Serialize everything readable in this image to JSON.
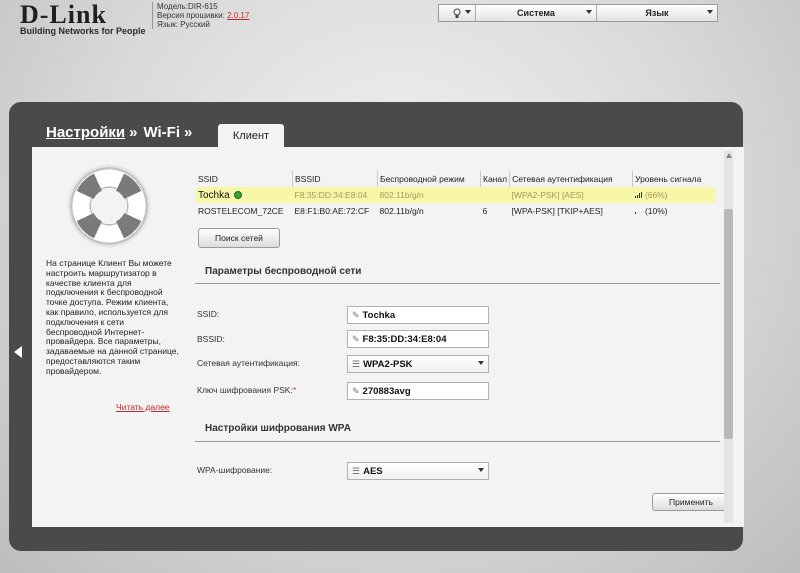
{
  "header": {
    "brand": "D-Link",
    "tagline": "Building Networks for People",
    "model": "Модель:DIR-615",
    "firmware_label": "Версия прошивки:",
    "firmware_version": "2.0.17",
    "language_info": "Язык: Русский",
    "menu": {
      "system": "Система",
      "language": "Язык"
    }
  },
  "breadcrumb": {
    "settings": "Настройки",
    "wifi": "Wi-Fi",
    "separator": "»",
    "tab": "Клиент"
  },
  "sidebar": {
    "help_text": "На странице Клиент Вы можете настроить маршрутизатор в качестве клиента для подключения к беспроводной точке доступа. Режим клиента, как правило, используется для подключения к сети беспроводной Интернет-провайдера. Все параметры, задаваемые на данной странице, предоставляются таким провайдером.",
    "read_more": "Читать далее"
  },
  "networks": {
    "columns": [
      "SSID",
      "BSSID",
      "Беспроводной режим",
      "Канал",
      "Сетевая аутентификация",
      "Уровень сигнала"
    ],
    "rows": [
      {
        "ssid": "Tochka",
        "bssid": "F8:35:DD:34:E8:04",
        "mode": "802.11b/g/n",
        "channel": "",
        "auth": "[WPA2-PSK] [AES]",
        "signal": "(66%)",
        "selected": true
      },
      {
        "ssid": "ROSTELECOM_72CE",
        "bssid": "E8:F1:B0:AE:72:CF",
        "mode": "802.11b/g/n",
        "channel": "6",
        "auth": "[WPA-PSK] [TKIP+AES]",
        "signal": "(10%)",
        "selected": false
      }
    ],
    "search_button": "Поиск сетей"
  },
  "wireless_params": {
    "title": "Параметры беспроводной сети",
    "ssid_label": "SSID:",
    "ssid_value": "Tochka",
    "bssid_label": "BSSID:",
    "bssid_value": "F8:35:DD:34:E8:04",
    "auth_label": "Сетевая аутентификация:",
    "auth_value": "WPA2-PSK",
    "psk_label": "Ключ шифрования PSK:",
    "psk_required": "*",
    "psk_value": "270883avg"
  },
  "wpa": {
    "title": "Настройки шифрования WPA",
    "enc_label": "WPA-шифрование:",
    "enc_value": "AES"
  },
  "apply_button": "Применить",
  "icons": {
    "menu_icon": "lightbulb-icon",
    "pencil": "pencil-icon",
    "list": "list-icon",
    "lifebuoy": "lifebuoy-icon",
    "back": "back-arrow-icon"
  }
}
